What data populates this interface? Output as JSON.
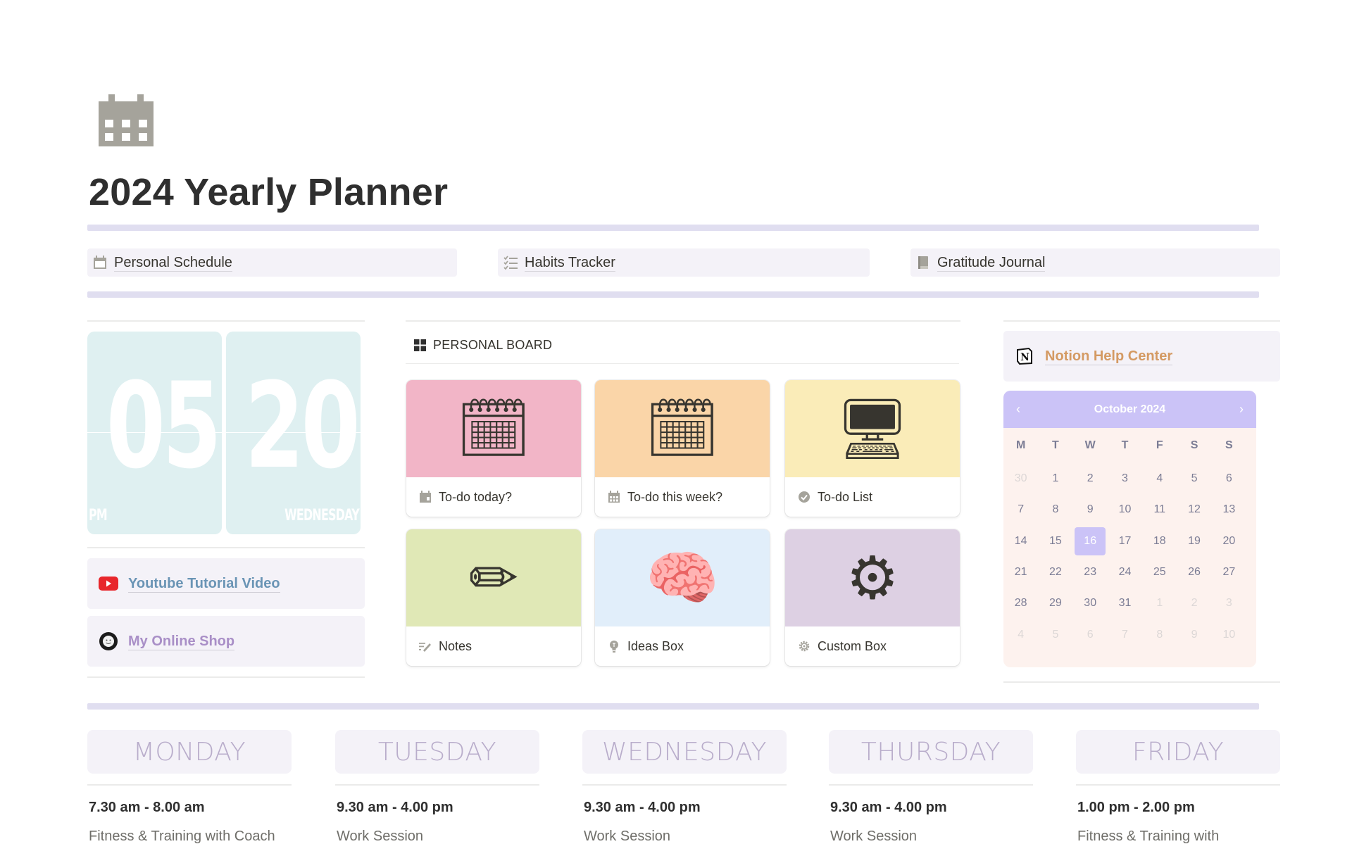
{
  "page": {
    "icon": "calendar-icon",
    "title": "2024 Yearly Planner"
  },
  "nav": [
    {
      "label": "Personal Schedule",
      "icon": "calendar-icon"
    },
    {
      "label": "Habits Tracker",
      "icon": "checklist-icon"
    },
    {
      "label": "Gratitude Journal",
      "icon": "book-icon"
    }
  ],
  "clock": {
    "hour": "05",
    "minute": "20",
    "ampm": "PM",
    "weekday": "WEDNESDAY"
  },
  "links": {
    "youtube": {
      "label": "Youtube Tutorial Video",
      "icon": "youtube-icon"
    },
    "shop": {
      "label": "My Online Shop",
      "icon": "shop-badge-icon"
    },
    "help": {
      "label": "Notion Help Center",
      "icon": "notion-icon"
    }
  },
  "board": {
    "title": "PERSONAL BOARD",
    "icon": "gallery-grid-icon",
    "cards": [
      {
        "label": "To-do today?",
        "icon": "calendar-day-icon",
        "cover": "spiral-calendar-emoji",
        "cover_glyph": "🗓",
        "cover_color": "#f2b5c7"
      },
      {
        "label": "To-do this week?",
        "icon": "calendar-week-icon",
        "cover": "spiral-calendar-emoji",
        "cover_glyph": "🗓",
        "cover_color": "#fad5a8"
      },
      {
        "label": "To-do List",
        "icon": "check-circle-icon",
        "cover": "desktop-computer-emoji",
        "cover_glyph": "🖥",
        "cover_color": "#faecb8"
      },
      {
        "label": "Notes",
        "icon": "notes-pencil-icon",
        "cover": "pencil-emoji",
        "cover_glyph": "✏",
        "cover_color": "#e0e8b6"
      },
      {
        "label": "Ideas Box",
        "icon": "lightbulb-icon",
        "cover": "brain-emoji",
        "cover_glyph": "🧠",
        "cover_color": "#e1eefa"
      },
      {
        "label": "Custom Box",
        "icon": "gear-icon",
        "cover": "gear-emoji",
        "cover_glyph": "⚙",
        "cover_color": "#ddd0e3"
      }
    ]
  },
  "calendar": {
    "title": "October 2024",
    "prev_label": "‹",
    "next_label": "›",
    "weekdays": [
      "M",
      "T",
      "W",
      "T",
      "F",
      "S",
      "S"
    ],
    "selected_day": "16",
    "weeks": [
      [
        {
          "d": "30",
          "m": true
        },
        {
          "d": "1"
        },
        {
          "d": "2"
        },
        {
          "d": "3"
        },
        {
          "d": "4"
        },
        {
          "d": "5"
        },
        {
          "d": "6"
        }
      ],
      [
        {
          "d": "7"
        },
        {
          "d": "8"
        },
        {
          "d": "9"
        },
        {
          "d": "10"
        },
        {
          "d": "11"
        },
        {
          "d": "12"
        },
        {
          "d": "13"
        }
      ],
      [
        {
          "d": "14"
        },
        {
          "d": "15"
        },
        {
          "d": "16",
          "t": true
        },
        {
          "d": "17"
        },
        {
          "d": "18"
        },
        {
          "d": "19"
        },
        {
          "d": "20"
        }
      ],
      [
        {
          "d": "21"
        },
        {
          "d": "22"
        },
        {
          "d": "23"
        },
        {
          "d": "24"
        },
        {
          "d": "25"
        },
        {
          "d": "26"
        },
        {
          "d": "27"
        }
      ],
      [
        {
          "d": "28"
        },
        {
          "d": "29"
        },
        {
          "d": "30"
        },
        {
          "d": "31"
        },
        {
          "d": "1",
          "m": true
        },
        {
          "d": "2",
          "m": true
        },
        {
          "d": "3",
          "m": true
        }
      ],
      [
        {
          "d": "4",
          "m": true
        },
        {
          "d": "5",
          "m": true
        },
        {
          "d": "6",
          "m": true
        },
        {
          "d": "7",
          "m": true
        },
        {
          "d": "8",
          "m": true
        },
        {
          "d": "9",
          "m": true
        },
        {
          "d": "10",
          "m": true
        }
      ]
    ]
  },
  "days": [
    {
      "name": "MONDAY",
      "time": "7.30 am - 8.00 am",
      "desc": "Fitness & Training with Coach"
    },
    {
      "name": "TUESDAY",
      "time": "9.30 am - 4.00 pm",
      "desc": "Work Session"
    },
    {
      "name": "WEDNESDAY",
      "time": "9.30 am - 4.00 pm",
      "desc": "Work Session"
    },
    {
      "name": "THURSDAY",
      "time": "9.30 am - 4.00 pm",
      "desc": "Work Session"
    },
    {
      "name": "FRIDAY",
      "time": "1.00 pm - 2.00 pm",
      "desc": "Fitness & Training with"
    }
  ],
  "colors": {
    "accent_purple": "#cbc3f7",
    "divider_purple": "#e0def0",
    "link_blue": "#6a94b5",
    "link_lilac": "#a98fc7",
    "link_orange": "#d49a63",
    "clock_bg": "#dff0f1",
    "calendar_bg": "#fdf2ee"
  }
}
